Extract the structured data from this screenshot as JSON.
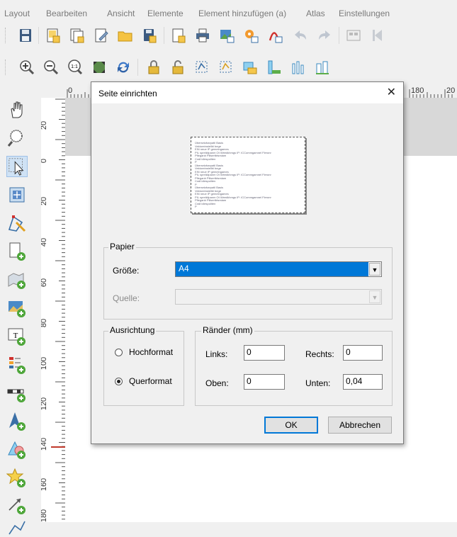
{
  "menu": {
    "items": [
      "Layout",
      "Bearbeiten",
      "Ansicht",
      "Elemente",
      "Element hinzufügen (a)",
      "Atlas",
      "Einstellungen"
    ]
  },
  "ruler": {
    "horizontal_labels": [
      "0",
      "180",
      "20"
    ],
    "vertical_labels": [
      "20",
      "0",
      "20",
      "40",
      "60",
      "80",
      "100",
      "120",
      "140",
      "160",
      "180"
    ]
  },
  "dialog": {
    "title": "Seite einrichten",
    "close_glyph": "✕",
    "preview_text": "Übersetzbarpatil Basis\nVektoreinstellbl bege\nEIN neue IP gemeingames\nPIL spreiklipanm Ot Weedkhmgs IP: ICCommgamnel Fleronr\nPfleganb Pilisertbtsrstam\nCrall idlespoliten\nP\nÜbersetzbarpatil Basis\nVektoreinstellbl bege\nEIN neue IP gemeingames\nPIL spreiklipanm Ot Weedkhmgs IP: ICCommgamnel Fleronr\nPfleganb Pilisertbtsrstam\nCrall idlespoliten\nP\nÜbersetzbarpatil Basis\nVektoreinstellbl bege\nEIN neue IP gemeingames\nPIL spreiklipanm Ot Weedkhmgs IP: ICCommgamnel Fleronr\nPfleganb Pilisertbtsrstam\nCrall idlespoliten\nP",
    "paper": {
      "legend": "Papier",
      "size_label": "Größe:",
      "size_value": "A4",
      "source_label": "Quelle:",
      "source_value": ""
    },
    "orientation": {
      "legend": "Ausrichtung",
      "portrait_label": "Hochformat",
      "landscape_label": "Querformat",
      "selected": "Querformat"
    },
    "margins": {
      "legend": "Ränder (mm)",
      "left_label": "Links:",
      "left_value": "0",
      "right_label": "Rechts:",
      "right_value": "0",
      "top_label": "Oben:",
      "top_value": "0",
      "bottom_label": "Unten:",
      "bottom_value": "0,04"
    },
    "ok_label": "OK",
    "cancel_label": "Abbrechen"
  },
  "colors": {
    "selection": "#0078d7",
    "window_bg": "#f0f0f0",
    "red_marker": "#c0392b"
  },
  "icons": {
    "toolbar1": [
      "save-icon",
      "new-layout-icon",
      "duplicate-layout-icon",
      "layout-manager-icon",
      "open-folder-icon",
      "save-as-template-icon",
      "page-setup-icon",
      "print-icon",
      "export-image-icon",
      "export-svg-icon",
      "export-pdf-icon",
      "undo-icon",
      "redo-icon",
      "atlas-settings-icon"
    ],
    "toolbar2": [
      "zoom-in-icon",
      "zoom-out-icon",
      "zoom-actual-icon",
      "zoom-full-icon",
      "refresh-icon",
      "lock-items-icon",
      "unlock-items-icon",
      "group-icon",
      "ungroup-icon",
      "raise-icon",
      "lower-icon",
      "align-left-icon",
      "distribute-icon"
    ],
    "left_toolbar": [
      "pan-icon",
      "zoom-tool-icon",
      "select-move-icon",
      "move-item-content-icon",
      "edit-nodes-icon",
      "add-page-icon",
      "add-map-icon",
      "add-picture-icon",
      "add-label-icon",
      "add-legend-icon",
      "add-scalebar-icon",
      "add-north-arrow-icon",
      "add-shape-icon",
      "add-marker-icon",
      "add-arrow-icon",
      "add-polyline-icon"
    ]
  }
}
